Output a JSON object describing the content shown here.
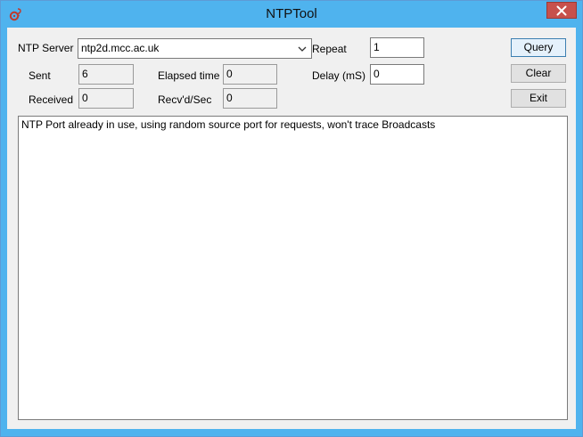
{
  "window": {
    "title": "NTPTool",
    "icon": "ntp-app-icon",
    "close_icon": "close-icon"
  },
  "form": {
    "server_label": "NTP Server",
    "server_value": "ntp2d.mcc.ac.uk",
    "repeat_label": "Repeat",
    "repeat_value": "1",
    "sent_label": "Sent",
    "sent_value": "6",
    "elapsed_label": "Elapsed time",
    "elapsed_value": "0",
    "delay_label": "Delay (mS)",
    "delay_value": "0",
    "received_label": "Received",
    "received_value": "0",
    "recv_sec_label": "Recv'd/Sec",
    "recv_sec_value": "0"
  },
  "buttons": {
    "query": "Query",
    "clear": "Clear",
    "exit": "Exit"
  },
  "output": {
    "text": "NTP Port already in use, using random source port for requests, won't trace Broadcasts"
  },
  "colors": {
    "titlebar": "#4fb3ee",
    "close_button": "#c7514c",
    "client_bg": "#f0f0f0"
  }
}
